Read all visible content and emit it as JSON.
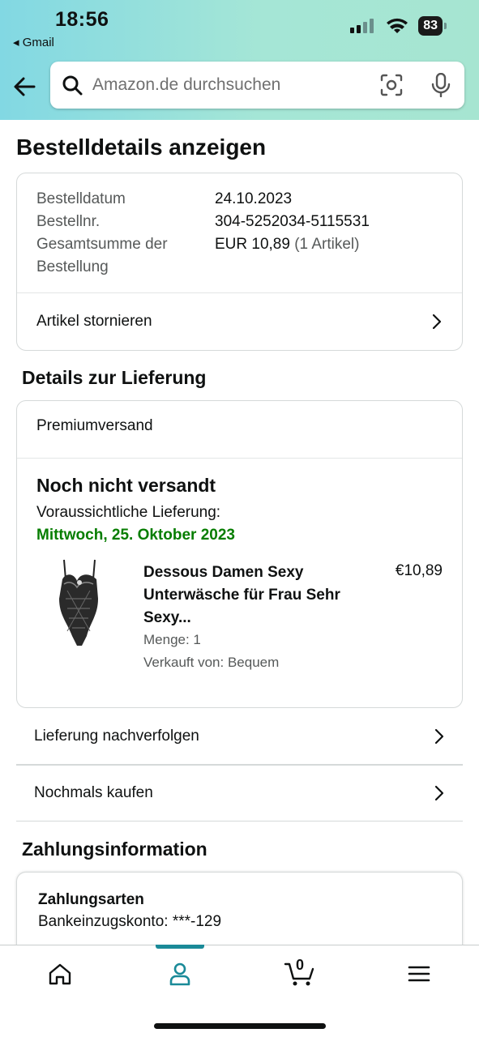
{
  "status_bar": {
    "time": "18:56",
    "back_app": "Gmail",
    "battery": "83"
  },
  "search": {
    "placeholder": "Amazon.de durchsuchen"
  },
  "page": {
    "title": "Bestelldetails anzeigen"
  },
  "order_summary": {
    "date_label": "Bestelldatum",
    "date_value": "24.10.2023",
    "number_label": "Bestellnr.",
    "number_value": "304-5252034-5115531",
    "total_label": "Gesamtsumme der Bestellung",
    "total_value": "EUR 10,89",
    "total_items": "(1 Artikel)",
    "cancel_label": "Artikel stornieren"
  },
  "delivery": {
    "heading": "Details zur Lieferung",
    "shipping_type": "Premiumversand",
    "status": "Noch nicht versandt",
    "eta_label": "Voraussichtliche Lieferung:",
    "eta_date": "Mittwoch, 25. Oktober 2023",
    "eta_color": "#067d00",
    "product": {
      "title": "Dessous Damen Sexy Unterwäsche für Frau Sehr Sexy...",
      "price": "€10,89",
      "quantity": "Menge: 1",
      "seller": "Verkauft von: Bequem"
    }
  },
  "actions": {
    "track": "Lieferung nachverfolgen",
    "buy_again": "Nochmals kaufen"
  },
  "payment": {
    "heading": "Zahlungsinformation",
    "method_title": "Zahlungsarten",
    "account": "Bankeinzugskonto: ***-129"
  },
  "tabbar": {
    "cart_count": "0",
    "active_color": "#1a8a98"
  }
}
